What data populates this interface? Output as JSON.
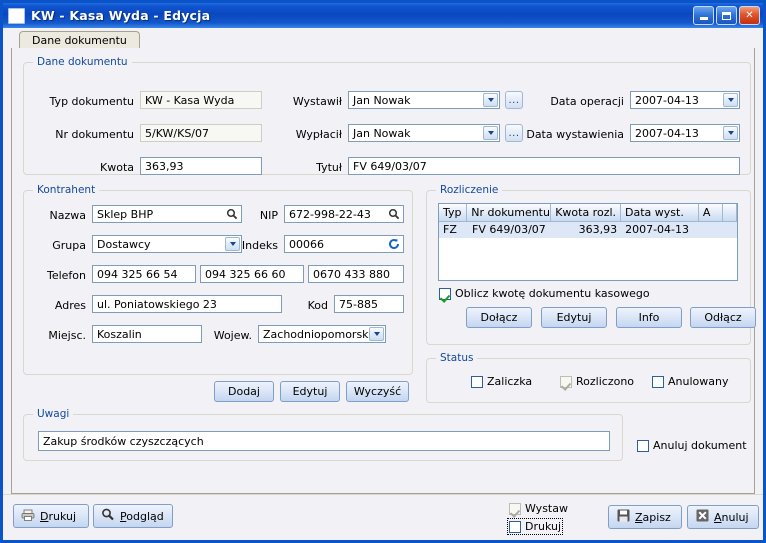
{
  "window": {
    "title": "KW - Kasa Wyda - Edycja",
    "minimize_label": "Minimalizuj",
    "maximize_label": "Maksymalizuj",
    "close_label": "Zamknij"
  },
  "tabs": [
    {
      "label": "Dane dokumentu"
    }
  ],
  "doc_group": {
    "legend": "Dane dokumentu",
    "typ_label": "Typ dokumentu",
    "typ_value": "KW - Kasa Wyda",
    "nr_label": "Nr dokumentu",
    "nr_value": "5/KW/KS/07",
    "kwota_label": "Kwota",
    "kwota_value": "363,93",
    "wystawil_label": "Wystawił",
    "wystawil_value": "Jan Nowak",
    "wyplacil_label": "Wypłacił",
    "wyplacil_value": "Jan Nowak",
    "browse_label": "...",
    "tytul_label": "Tytuł",
    "tytul_value": "FV 649/03/07",
    "data_operacji_label": "Data operacji",
    "data_operacji_value": "2007-04-13",
    "data_wystawienia_label": "Data wystawienia",
    "data_wystawienia_value": "2007-04-13"
  },
  "kontrahent": {
    "legend": "Kontrahent",
    "nazwa_label": "Nazwa",
    "nazwa_value": "Sklep BHP",
    "nip_label": "NIP",
    "nip_value": "672-998-22-43",
    "grupa_label": "Grupa",
    "grupa_value": "Dostawcy",
    "indeks_label": "Indeks",
    "indeks_value": "00066",
    "telefon_label": "Telefon",
    "telefon1_value": "094 325 66 54",
    "telefon2_value": "094 325 66 60",
    "telefon3_value": "0670 433 880",
    "adres_label": "Adres",
    "adres_value": "ul. Poniatowskiego 23",
    "kod_label": "Kod",
    "kod_value": "75-885",
    "miejsc_label": "Miejsc.",
    "miejsc_value": "Koszalin",
    "wojew_label": "Wojew.",
    "wojew_value": "Zachodniopomorskie",
    "dodaj_label": "Dodaj",
    "edytuj_label": "Edytuj",
    "wyczysc_label": "Wyczyść"
  },
  "rozliczenie": {
    "legend": "Rozliczenie",
    "columns": [
      "Typ",
      "Nr dokumentu",
      "Kwota rozl.",
      "Data wyst.",
      "A",
      ""
    ],
    "rows": [
      {
        "typ": "FZ",
        "nr": "FV 649/03/07",
        "kwota": "363,93",
        "data": "2007-04-13",
        "a": "",
        "x": ""
      }
    ],
    "oblicz_label": "Oblicz kwotę dokumentu kasowego",
    "oblicz_checked": true,
    "dolacz_label": "Dołącz",
    "edytuj_label": "Edytuj",
    "info_label": "Info",
    "odlacz_label": "Odłącz"
  },
  "status": {
    "legend": "Status",
    "zaliczka_label": "Zaliczka",
    "zaliczka_checked": false,
    "rozliczono_label": "Rozliczono",
    "rozliczono_checked": true,
    "anulowany_label": "Anulowany",
    "anulowany_checked": false
  },
  "uwagi": {
    "legend": "Uwagi",
    "value": "Zakup środków czyszczących",
    "anuluj_dokument_label": "Anuluj dokument",
    "anuluj_dokument_checked": false
  },
  "footer": {
    "drukuj_label": "Drukuj",
    "drukuj_accel": "D",
    "podglad_label": "Podgląd",
    "podglad_accel": "P",
    "wystaw_label": "Wystaw",
    "wystaw_checked": true,
    "drukuj_cb_label": "Drukuj",
    "drukuj_cb_checked": false,
    "zapisz_label": "Zapisz",
    "zapisz_accel": "Z",
    "anuluj_label": "Anuluj",
    "anuluj_accel": "A"
  },
  "colors": {
    "title_blue": "#0a47c0",
    "legend_blue": "#12499c",
    "dialog_bg": "#f2f2f6",
    "selection_blue": "#dde7f5",
    "check_green": "#1c9a28"
  }
}
